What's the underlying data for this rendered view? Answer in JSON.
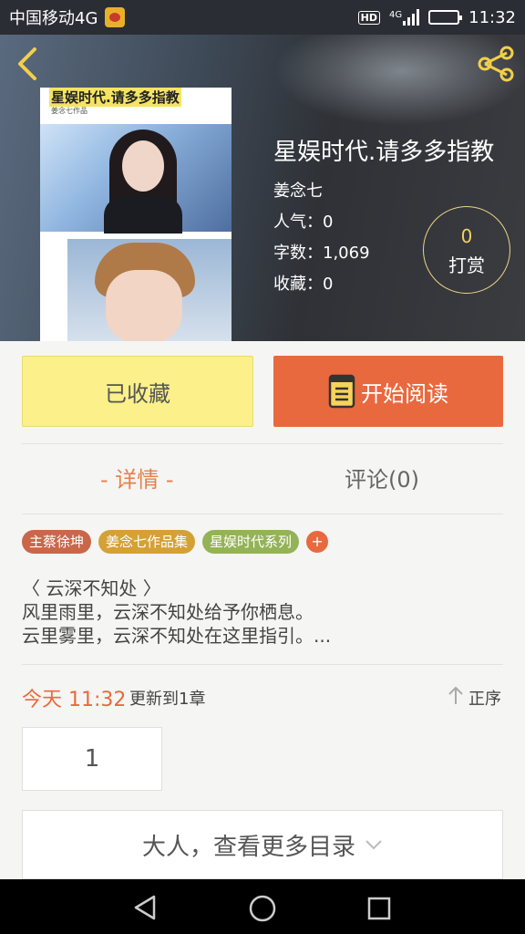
{
  "status_bar": {
    "carrier": "中国移动4G",
    "hd": "HD",
    "network": "4G",
    "time": "11:32",
    "battery_level": 0.7
  },
  "header": {
    "icons": {
      "back": "chevron-left-icon",
      "share": "share-icon"
    },
    "cover": {
      "title": "星娱时代.请多多指教",
      "author": "姜念七作品"
    },
    "title": "星娱时代.请多多指教",
    "author": "姜念七",
    "popularity": "人气：0",
    "word_count": "字数：1,069",
    "favorites": "收藏：0",
    "reward": {
      "count": "0",
      "label": "打赏"
    }
  },
  "actions": {
    "collected_label": "已收藏",
    "read_label": "开始阅读",
    "read_icon": "book-icon"
  },
  "tabs": {
    "details": "- 详情 -",
    "comments": "评论(0)"
  },
  "tags": [
    {
      "label": "主蔡徐坤",
      "color": "#c9674b"
    },
    {
      "label": "姜念七作品集",
      "color": "#d4a137"
    },
    {
      "label": "星娱时代系列",
      "color": "#94b257"
    }
  ],
  "tag_add_label": "+",
  "synopsis": {
    "line1": "〈 云深不知处 〉",
    "line2": "风里雨里，云深不知处给予你栖息。",
    "line3": "云里雾里，云深不知处在这里指引。..."
  },
  "update": {
    "time": "今天 11:32",
    "text": "更新到1章",
    "sort_label": "正序",
    "sort_icon": "arrow-up-icon"
  },
  "chapter": {
    "number": "1"
  },
  "more_catalog": {
    "label": "大人，查看更多目录",
    "icon": "chevron-down-icon"
  },
  "colors": {
    "accent": "#e8693d",
    "collected_bg": "#fbf089",
    "tab_active": "#e8804a"
  }
}
